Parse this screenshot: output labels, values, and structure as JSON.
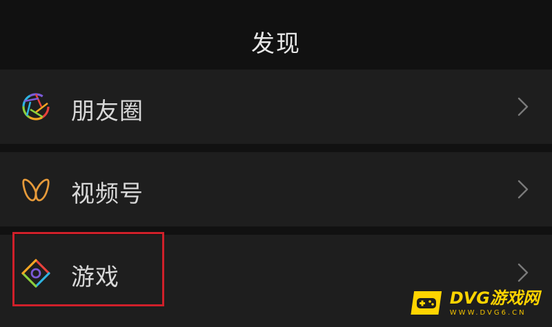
{
  "header": {
    "title": "发现"
  },
  "items": [
    {
      "label": "朋友圈",
      "icon": "moments-aperture-icon"
    },
    {
      "label": "视频号",
      "icon": "channels-butterfly-icon"
    },
    {
      "label": "游戏",
      "icon": "games-diamond-icon"
    }
  ],
  "colors": {
    "background": "#111111",
    "row_background": "#1e1e1e",
    "text": "#d8d8d8",
    "chevron": "#7a7a7a",
    "highlight": "#d0202a",
    "watermark": "#ffd400"
  },
  "watermark": {
    "title": "DVG游戏网",
    "subtitle": "WWW.DVG6.CN"
  }
}
